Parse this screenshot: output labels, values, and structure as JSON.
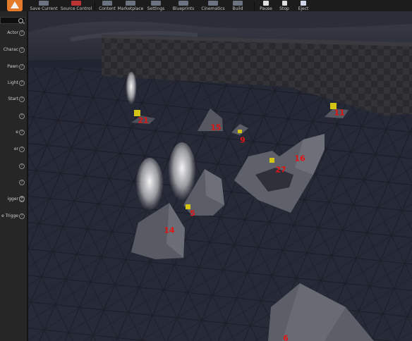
{
  "toolbar": {
    "buttons": [
      {
        "name": "save-current",
        "label": "Save Current",
        "icon": "save-icon"
      },
      {
        "name": "source-control",
        "label": "Source Control",
        "icon": "source-control-icon"
      },
      {
        "name": "content",
        "label": "Content",
        "icon": "content-icon"
      },
      {
        "name": "marketplace",
        "label": "Marketplace",
        "icon": "marketplace-icon"
      },
      {
        "name": "settings",
        "label": "Settings",
        "icon": "settings-icon"
      },
      {
        "name": "blueprints",
        "label": "Blueprints",
        "icon": "blueprints-icon"
      },
      {
        "name": "cinematics",
        "label": "Cinematics",
        "icon": "cinematics-icon"
      },
      {
        "name": "build",
        "label": "Build",
        "icon": "build-icon"
      },
      {
        "name": "pause",
        "label": "Pause",
        "icon": "pause-icon"
      },
      {
        "name": "stop",
        "label": "Stop",
        "icon": "stop-icon"
      },
      {
        "name": "eject",
        "label": "Eject",
        "icon": "eject-icon"
      }
    ]
  },
  "left_panel": {
    "classes": [
      "Actor",
      "Charac",
      "Pawn",
      "Light",
      "Start",
      "",
      "e",
      "er",
      "",
      "",
      "",
      "igger",
      "e Trigge"
    ]
  },
  "viewport": {
    "labels": [
      {
        "id": "label-21",
        "text": "21"
      },
      {
        "id": "label-15",
        "text": "15"
      },
      {
        "id": "label-9",
        "text": "9"
      },
      {
        "id": "label-11",
        "text": "11"
      },
      {
        "id": "label-16",
        "text": "16"
      },
      {
        "id": "label-27",
        "text": "27"
      },
      {
        "id": "label-5",
        "text": "5"
      },
      {
        "id": "label-14",
        "text": "14"
      },
      {
        "id": "label-6",
        "text": "6"
      }
    ]
  },
  "colors": {
    "label": "#e01414",
    "marker": "#d4c414",
    "rock": "#5a5c66",
    "floor": "#2a2d3a",
    "accent": "#e47b2a"
  }
}
